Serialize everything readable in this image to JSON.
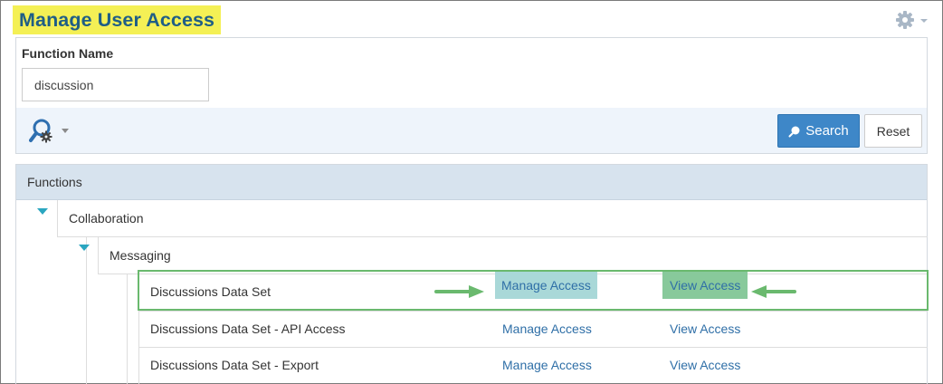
{
  "page": {
    "title": "Manage User Access"
  },
  "search": {
    "field_label": "Function Name",
    "field_value": "discussion",
    "search_button": "Search",
    "reset_button": "Reset"
  },
  "tree": {
    "header": "Functions",
    "level1_label": "Collaboration",
    "level2_label": "Messaging",
    "rows": [
      {
        "name": "Discussions Data Set",
        "manage": "Manage Access",
        "view": "View Access",
        "highlighted": true
      },
      {
        "name": "Discussions Data Set - API Access",
        "manage": "Manage Access",
        "view": "View Access",
        "highlighted": false
      },
      {
        "name": "Discussions Data Set - Export",
        "manage": "Manage Access",
        "view": "View Access",
        "highlighted": false
      }
    ]
  },
  "colors": {
    "title_highlight": "#f4f055",
    "title_text": "#1f5e86",
    "link": "#2f6fa7",
    "search_button": "#3e87c8",
    "manage_highlight": "#a9d8d8",
    "view_highlight": "#88c99b",
    "annotation_green": "#6ab96e",
    "caret": "#2aa6c0"
  },
  "icons": [
    "gear-icon",
    "search-settings-icon",
    "magnifier-icon",
    "caret-down-icon",
    "arrow-right-icon",
    "arrow-left-icon"
  ]
}
